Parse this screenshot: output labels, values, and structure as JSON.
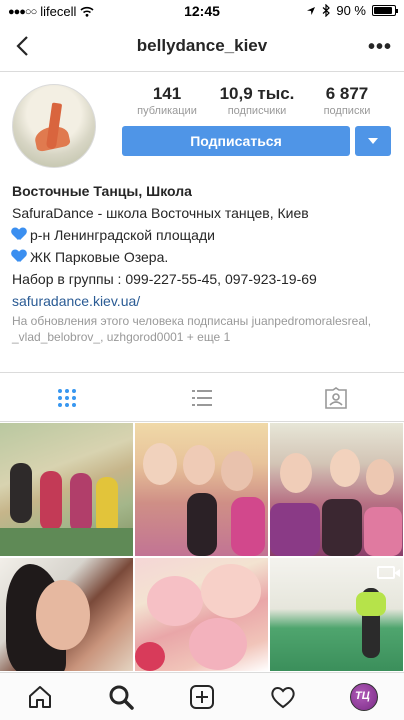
{
  "status": {
    "carrier": "lifecell",
    "time": "12:45",
    "battery": "90 %",
    "battery_level": 0.9
  },
  "nav": {
    "title": "bellydance_kiev",
    "more": "•••"
  },
  "stats": [
    {
      "value": "141",
      "label": "публикации"
    },
    {
      "value": "10,9 тыс.",
      "label": "подписчики"
    },
    {
      "value": "6 877",
      "label": "подписки"
    }
  ],
  "follow_label": "Подписаться",
  "bio": {
    "name": "Восточные Танцы, Школа",
    "line1": "SafuraDance - школа Восточных танцев, Киев",
    "line2": "р-н Ленинградской площади",
    "line3": "ЖК Парковые Озера.",
    "line4": "Набор в группы : 099-227-55-45, 097-923-19-69",
    "link": "safuradance.kiev.ua/"
  },
  "followed_by": "На обновления этого человека подписаны juanpedromoralesreal, _vlad_belobrov_, uzhgorod0001 + еще 1",
  "profile_badge": "ТЦ",
  "colors": {
    "accent": "#4f95e7",
    "link": "#2a5b94",
    "grid_active": "#3897f0"
  },
  "icons": [
    "back-icon",
    "more-icon",
    "grid-icon",
    "list-icon",
    "tagged-icon",
    "video-icon",
    "home-icon",
    "search-icon",
    "add-icon",
    "heart-icon",
    "profile-icon"
  ]
}
